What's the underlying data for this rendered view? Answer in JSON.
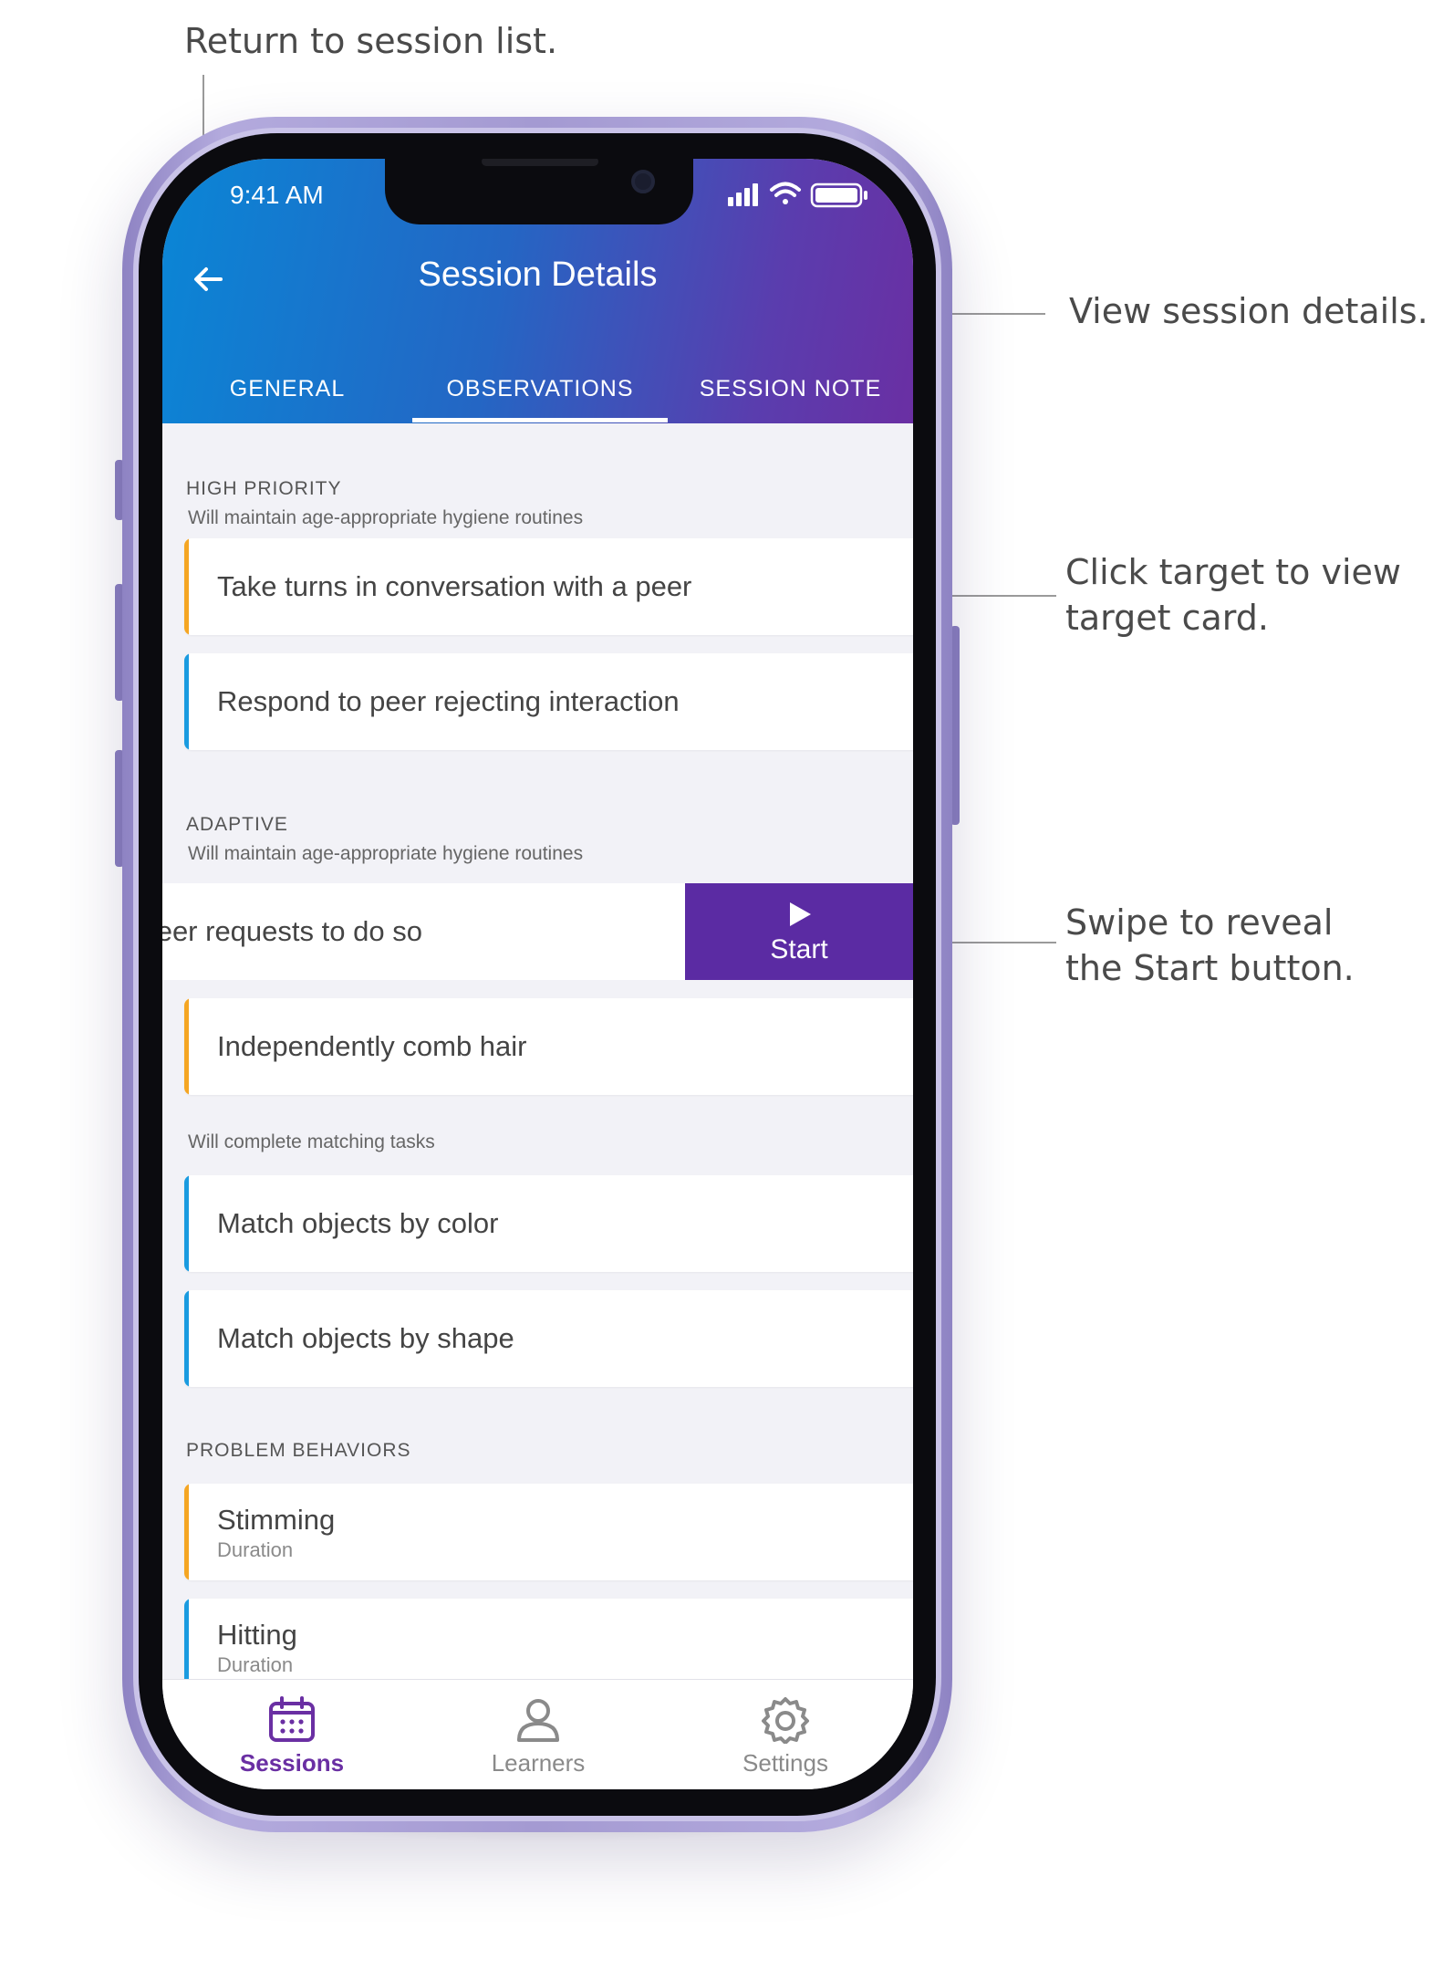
{
  "annotations": {
    "return": "Return to session list.",
    "view_details": "View session details.",
    "click_target_line1": "Click target to view",
    "click_target_line2": "target card.",
    "swipe_line1": "Swipe to reveal",
    "swipe_line2": "the Start button."
  },
  "status_bar": {
    "time": "9:41 AM"
  },
  "header": {
    "title": "Session Details",
    "tabs": [
      {
        "label": "GENERAL",
        "active": false
      },
      {
        "label": "OBSERVATIONS",
        "active": true
      },
      {
        "label": "SESSION NOTE",
        "active": false
      }
    ],
    "gradient": [
      "#0a86d6",
      "#6a2fa3"
    ]
  },
  "sections": {
    "high_priority": {
      "title": "HIGH PRIORITY",
      "subtitle": "Will maintain age-appropriate hygiene routines",
      "items": [
        {
          "label": "Take turns in conversation with a peer",
          "color": "#f5a623"
        },
        {
          "label": "Respond to peer rejecting interaction",
          "color": "#1a9be0"
        }
      ]
    },
    "adaptive": {
      "title": "ADAPTIVE",
      "subtitle": "Will maintain age-appropriate hygiene routines",
      "swiped_item": {
        "label": "ities when peer requests to do so",
        "action_label": "Start"
      },
      "items": [
        {
          "label": "Independently comb hair",
          "color": "#f5a623"
        }
      ],
      "subtitle2": "Will complete matching tasks",
      "items2": [
        {
          "label": "Match objects by color",
          "color": "#1a9be0"
        },
        {
          "label": "Match objects by shape",
          "color": "#1a9be0"
        }
      ]
    },
    "problem_behaviors": {
      "title": "PROBLEM BEHAVIORS",
      "items": [
        {
          "label": "Stimming",
          "meta": "Duration",
          "color": "#f5a623"
        },
        {
          "label": "Hitting",
          "meta": "Duration",
          "color": "#1a9be0"
        }
      ]
    }
  },
  "tabbar": {
    "items": [
      {
        "label": "Sessions",
        "icon": "calendar-icon",
        "active": true
      },
      {
        "label": "Learners",
        "icon": "person-icon",
        "active": false
      },
      {
        "label": "Settings",
        "icon": "gear-icon",
        "active": false
      }
    ],
    "active_color": "#6a2fa3",
    "inactive_color": "#8a8a8a"
  },
  "colors": {
    "accent_purple": "#5b2ba3",
    "orange": "#f5a623",
    "blue": "#1a9be0"
  }
}
